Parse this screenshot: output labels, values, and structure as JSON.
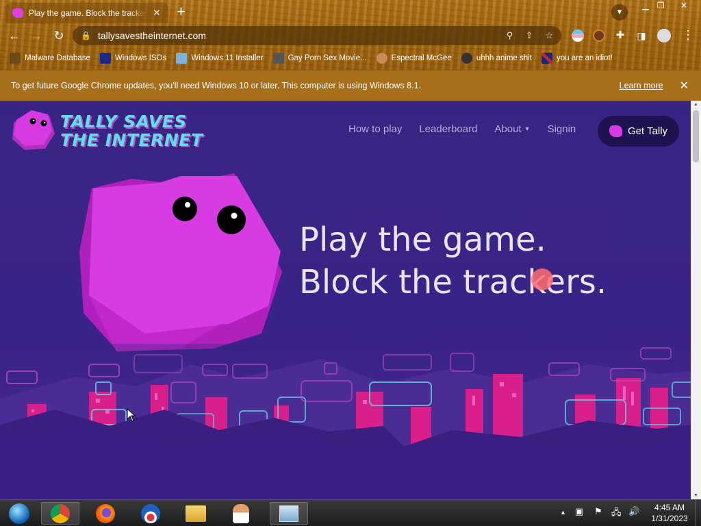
{
  "browser": {
    "tab_title": "Play the game. Block the trackers",
    "tab_close": "✕",
    "new_tab": "+",
    "url": "tallysavestheinternet.com",
    "bookmarks": [
      {
        "label": "Malware Database",
        "icon_color": "#6b4a1a"
      },
      {
        "label": "Windows ISOs",
        "icon_color": "#1b2a8a"
      },
      {
        "label": "Windows 11 Installer",
        "icon_color": "#7db3d8"
      },
      {
        "label": "Gay Porn Sex Movie...",
        "icon_color": "#555555"
      },
      {
        "label": "Espectral McGee",
        "icon_color": "#c98b5a"
      },
      {
        "label": "uhhh anime shit",
        "icon_color": "#333333"
      },
      {
        "label": "you are an idiot!",
        "icon_color": "#c62828"
      }
    ]
  },
  "infobar": {
    "message": "To get future Google Chrome updates, you'll need Windows 10 or later. This computer is using Windows 8.1.",
    "learn_more": "Learn more"
  },
  "site": {
    "logo_line1": "TALLY SAVES",
    "logo_line2": "THE INTERNET",
    "nav": {
      "how_to_play": "How to play",
      "leaderboard": "Leaderboard",
      "about": "About",
      "signin": "Signin"
    },
    "cta": "Get Tally",
    "hero_line1": "Play the game.",
    "hero_line2": "Block the trackers.",
    "colors": {
      "background": "#3a2386",
      "tally_pink": "#d63be2",
      "logo_cyan": "#5fe0e8",
      "skyline_pink": "#e91e8c"
    }
  },
  "taskbar": {
    "time": "4:45 AM",
    "date": "1/31/2023",
    "apps": [
      "start-orb",
      "chrome",
      "firefox",
      "obama-logo-app",
      "file-explorer",
      "user-app",
      "remote-desktop"
    ]
  }
}
